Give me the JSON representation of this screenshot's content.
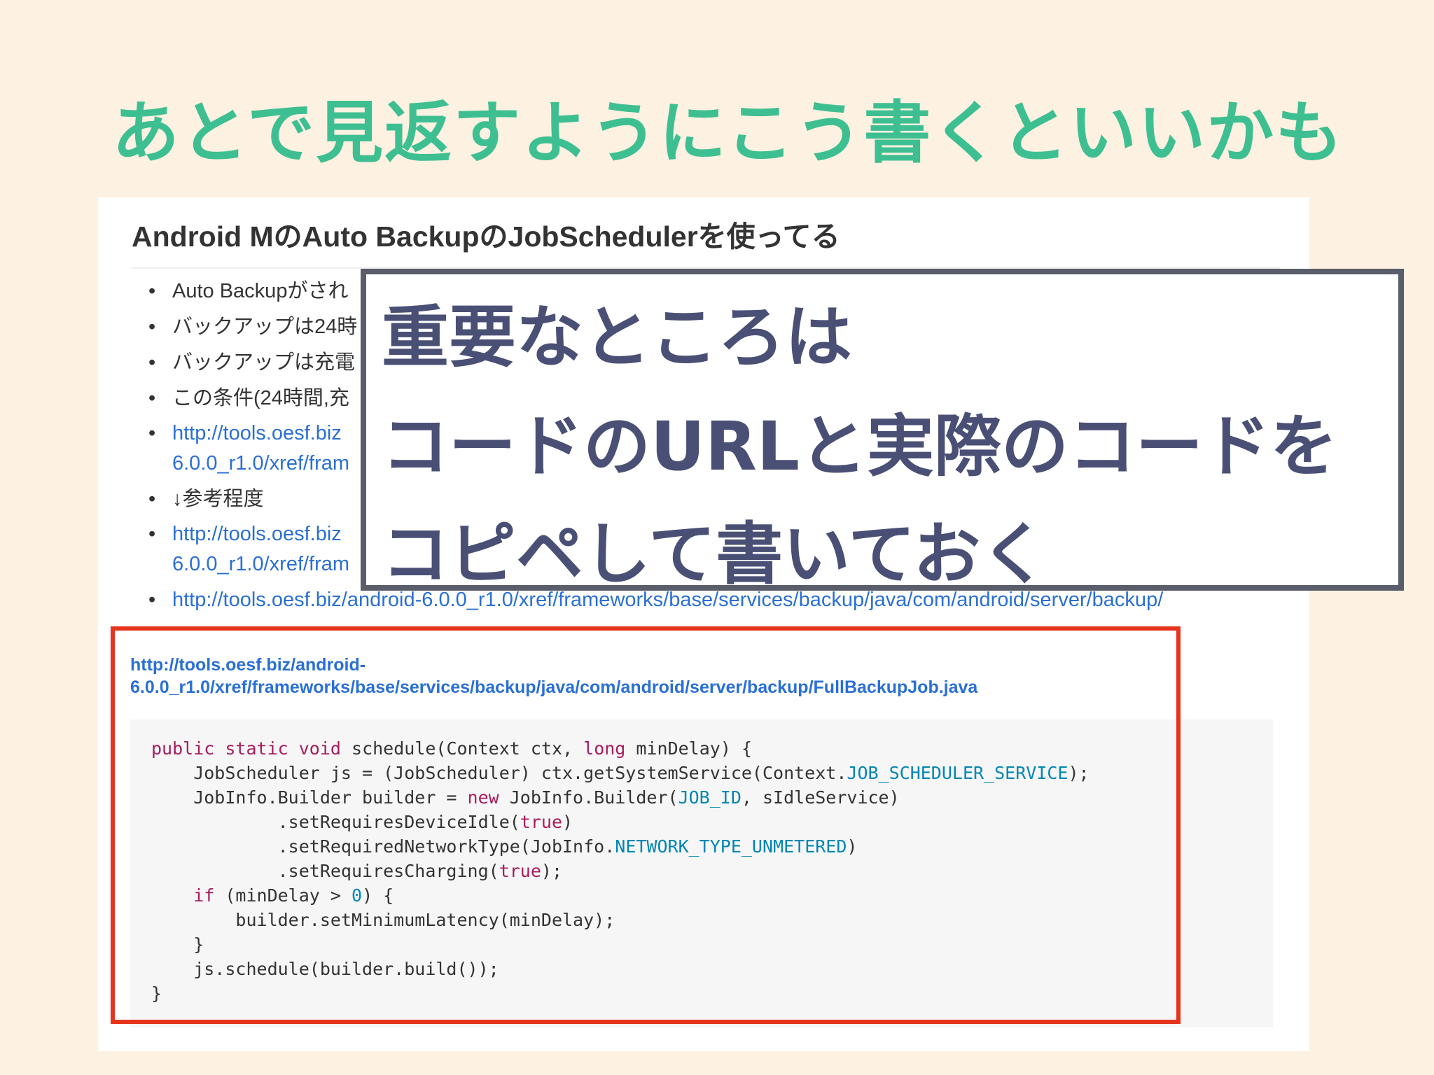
{
  "slide": {
    "title": "あとで見返すようにこう書くといいかも"
  },
  "doc": {
    "heading": "Android MのAuto BackupのJobSchedulerを使ってる",
    "bullets": [
      {
        "text": "Auto Backupがされ"
      },
      {
        "text": "バックアップは24時"
      },
      {
        "text": "バックアップは充電"
      },
      {
        "text": "この条件(24時間,充"
      },
      {
        "link_line1": "http://tools.oesf.biz",
        "link_line2": "6.0.0_r1.0/xref/fram"
      },
      {
        "text": "↓参考程度"
      },
      {
        "link_line1": "http://tools.oesf.biz",
        "link_line2": "6.0.0_r1.0/xref/fram"
      },
      {
        "link": "http://tools.oesf.biz/android-6.0.0_r1.0/xref/frameworks/base/services/backup/java/com/android/server/backup/"
      }
    ]
  },
  "callout": {
    "line1": "重要なところは",
    "line2": "コードのURLと実際のコードを",
    "line3": "コピペして書いておく"
  },
  "code": {
    "link_line1": "http://tools.oesf.biz/android-",
    "link_line2": "6.0.0_r1.0/xref/frameworks/base/services/backup/java/com/android/server/backup/FullBackupJob.java",
    "lines": [
      "public static void schedule(Context ctx, long minDelay) {",
      "    JobScheduler js = (JobScheduler) ctx.getSystemService(Context.JOB_SCHEDULER_SERVICE);",
      "    JobInfo.Builder builder = new JobInfo.Builder(JOB_ID, sIdleService)",
      "            .setRequiresDeviceIdle(true)",
      "            .setRequiredNetworkType(JobInfo.NETWORK_TYPE_UNMETERED)",
      "            .setRequiresCharging(true);",
      "    if (minDelay > 0) {",
      "        builder.setMinimumLatency(minDelay);",
      "    }",
      "    js.schedule(builder.build());",
      "}"
    ]
  },
  "colors": {
    "title": "#3ebf92",
    "link": "#2a6fd6",
    "callout_text": "#4a5075",
    "callout_border": "#5a5e6b",
    "highlight_border": "#e5331c",
    "keyword": "#a71d5d",
    "constant": "#0086b3",
    "background": "#fdf1e1"
  }
}
